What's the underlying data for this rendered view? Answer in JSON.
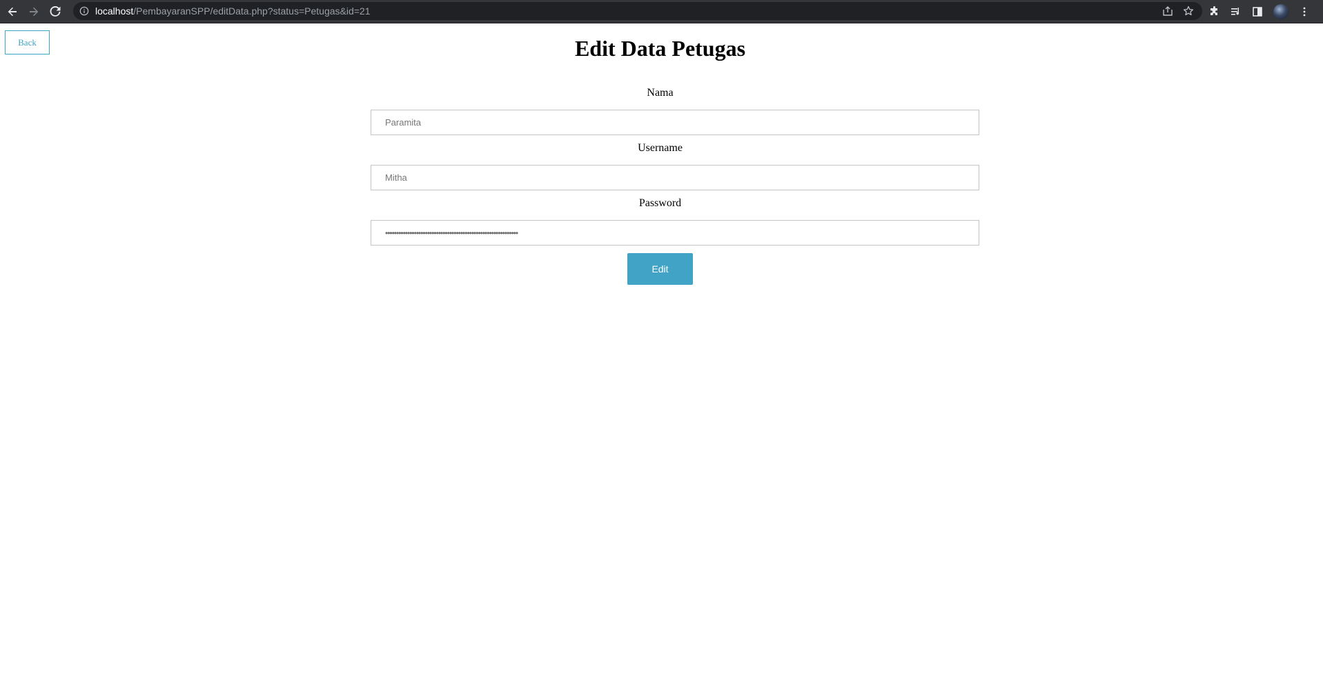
{
  "browser": {
    "url_host": "localhost",
    "url_path": "/PembayaranSPP/editData.php?status=Petugas&id=21"
  },
  "page": {
    "back_label": "Back",
    "title": "Edit Data Petugas",
    "submit_label": "Edit"
  },
  "form": {
    "nama": {
      "label": "Nama",
      "value": "Paramita"
    },
    "username": {
      "label": "Username",
      "value": "Mitha"
    },
    "password": {
      "label": "Password",
      "value": "••••••••••••••••••••••••••••••••••••••••••••••••••••••••••••"
    }
  },
  "colors": {
    "accent": "#41a3c6",
    "chrome_bg": "#35363a",
    "omnibox_bg": "#202124"
  },
  "icons": [
    "back-arrow-icon",
    "forward-arrow-icon",
    "reload-icon",
    "info-icon",
    "share-icon",
    "star-icon",
    "extensions-icon",
    "reading-list-icon",
    "side-panel-icon",
    "avatar",
    "more-icon"
  ]
}
